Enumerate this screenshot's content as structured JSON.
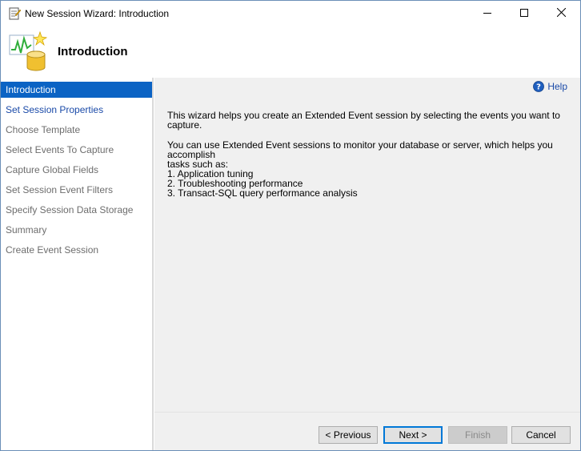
{
  "window": {
    "title": "New Session Wizard: Introduction"
  },
  "header": {
    "title": "Introduction"
  },
  "sidebar": {
    "items": [
      {
        "label": "Introduction",
        "state": "active"
      },
      {
        "label": "Set Session Properties",
        "state": "link"
      },
      {
        "label": "Choose Template",
        "state": "disabled"
      },
      {
        "label": "Select Events To Capture",
        "state": "disabled"
      },
      {
        "label": "Capture Global Fields",
        "state": "disabled"
      },
      {
        "label": "Set Session Event Filters",
        "state": "disabled"
      },
      {
        "label": "Specify Session Data Storage",
        "state": "disabled"
      },
      {
        "label": "Summary",
        "state": "disabled"
      },
      {
        "label": "Create Event Session",
        "state": "disabled"
      }
    ]
  },
  "content": {
    "help_label": "Help",
    "paragraph1": "This wizard helps you create an Extended Event session by selecting the events you want to capture.",
    "paragraph2_line1": "You can use Extended Event sessions to monitor your database or server, which helps you accomplish",
    "paragraph2_line2": "tasks such as:",
    "tasks": [
      "1. Application tuning",
      "2. Troubleshooting performance",
      "3. Transact-SQL query performance analysis"
    ]
  },
  "footer": {
    "previous_label": "< Previous",
    "next_label": "Next >",
    "finish_label": "Finish",
    "cancel_label": "Cancel"
  },
  "colors": {
    "accent": "#0b63c4",
    "link": "#1a4aa8",
    "panel": "#f0f0f0"
  }
}
